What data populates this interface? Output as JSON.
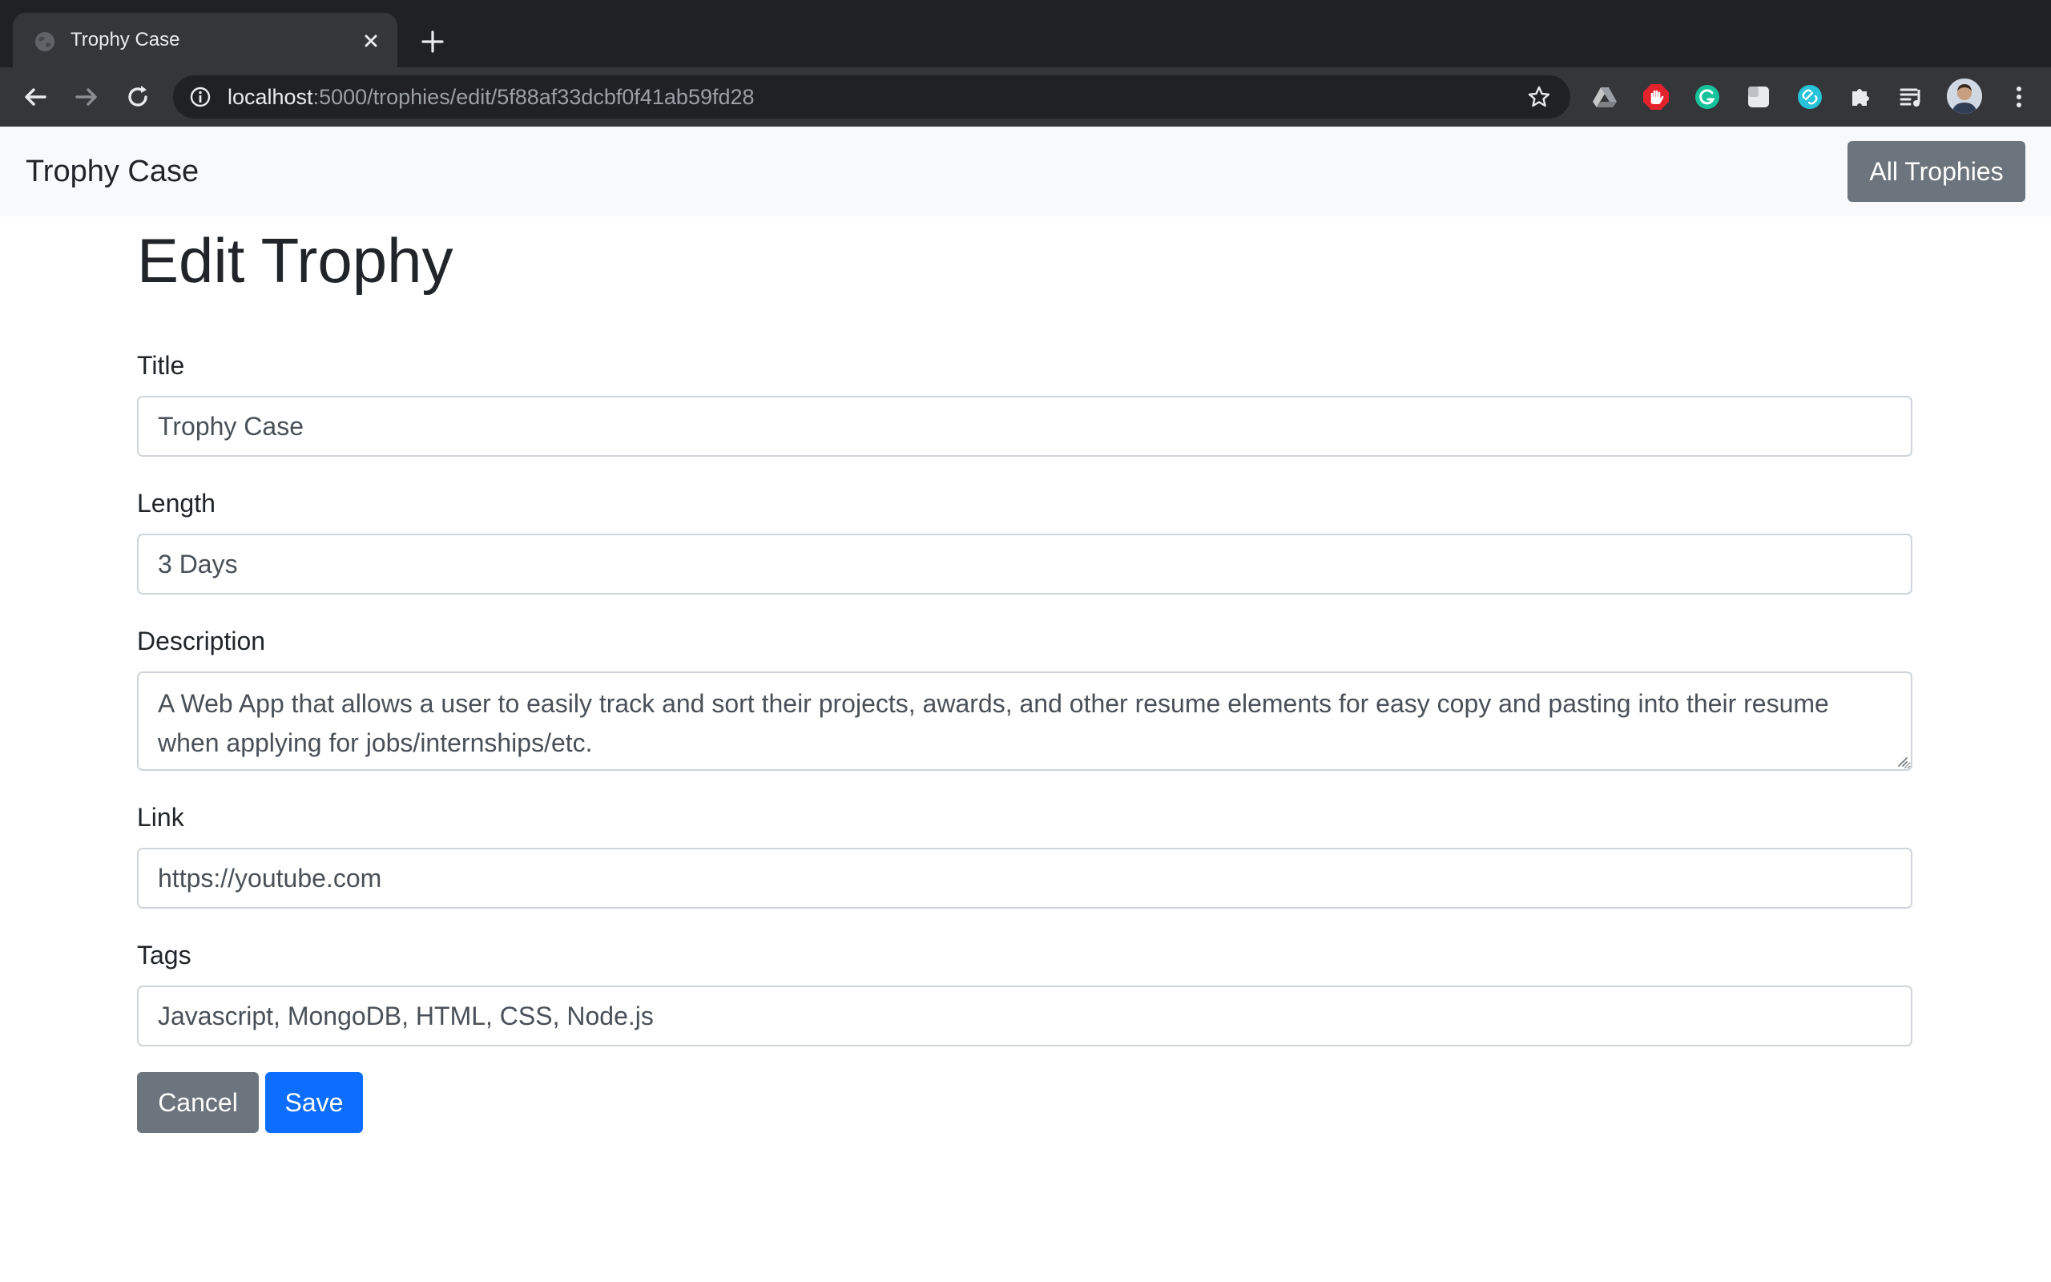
{
  "browser": {
    "tab": {
      "title": "Trophy Case"
    },
    "address": {
      "host": "localhost",
      "rest": ":5000/trophies/edit/5f88af33dcbf0f41ab59fd28"
    }
  },
  "navbar": {
    "brand": "Trophy Case",
    "all_trophies_label": "All Trophies"
  },
  "page": {
    "heading": "Edit Trophy"
  },
  "form": {
    "title": {
      "label": "Title",
      "value": "Trophy Case"
    },
    "length": {
      "label": "Length",
      "value": "3 Days"
    },
    "description": {
      "label": "Description",
      "value": "A Web App that allows a user to easily track and sort their projects, awards, and other resume elements for easy copy and pasting into their resume when applying for jobs/internships/etc."
    },
    "link": {
      "label": "Link",
      "value": "https://youtube.com"
    },
    "tags": {
      "label": "Tags",
      "value": "Javascript, MongoDB, HTML, CSS, Node.js"
    },
    "cancel_label": "Cancel",
    "save_label": "Save"
  },
  "colors": {
    "primary": "#0d6efd",
    "secondary": "#6c757d",
    "navbar_bg": "#f8f9fa",
    "chrome_dark": "#202124",
    "chrome_toolbar": "#35363a"
  }
}
